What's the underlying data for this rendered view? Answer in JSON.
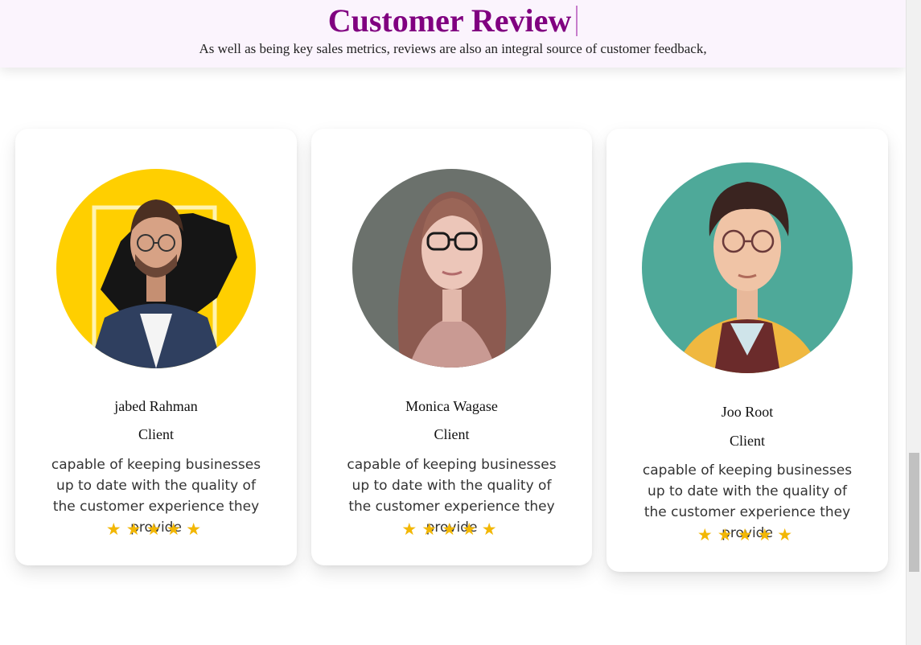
{
  "header": {
    "title": "Customer Review",
    "subtitle": "As well as being key sales metrics, reviews are also an integral source of customer feedback,"
  },
  "reviews": [
    {
      "name": "jabed Rahman",
      "role": "Client",
      "quote": "capable of keeping businesses up to date with the quality of the customer experience they provide",
      "stars": "★★★★★",
      "rating": 5,
      "avatar_icon": "man-glasses-yellow-bg-avatar"
    },
    {
      "name": "Monica Wagase",
      "role": "Client",
      "quote": "capable of keeping businesses up to date with the quality of the customer experience they provide",
      "stars": "★★★★★",
      "rating": 5,
      "avatar_icon": "woman-glasses-avatar"
    },
    {
      "name": "Joo Root",
      "role": "Client",
      "quote": "capable of keeping businesses up to date with the quality of the customer experience they provide",
      "stars": "★★★★★",
      "rating": 5,
      "avatar_icon": "young-man-glasses-teal-bg-avatar"
    }
  ],
  "colors": {
    "title": "#800080",
    "header_bg": "#fbf4fd",
    "star": "#f2b705"
  }
}
